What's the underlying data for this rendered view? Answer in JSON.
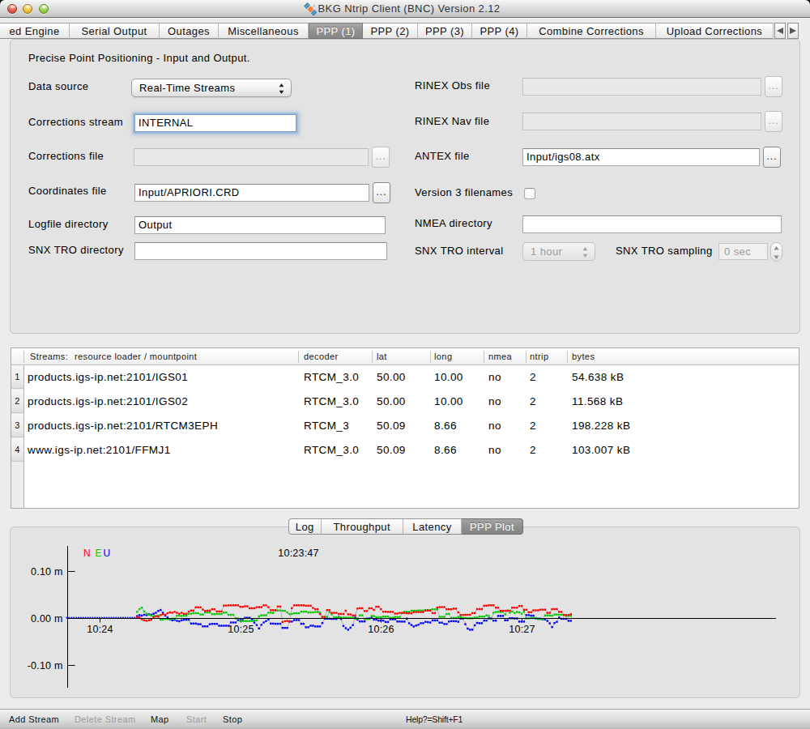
{
  "window": {
    "title": "BKG Ntrip Client (BNC) Version 2.12",
    "traffic_lights": [
      "close",
      "minimize",
      "zoom"
    ]
  },
  "tabs": {
    "items": [
      {
        "label": "ed Engine",
        "selected": false
      },
      {
        "label": "Serial Output",
        "selected": false
      },
      {
        "label": "Outages",
        "selected": false
      },
      {
        "label": "Miscellaneous",
        "selected": false
      },
      {
        "label": "PPP (1)",
        "selected": true
      },
      {
        "label": "PPP (2)",
        "selected": false
      },
      {
        "label": "PPP (3)",
        "selected": false
      },
      {
        "label": "PPP (4)",
        "selected": false
      },
      {
        "label": "Combine Corrections",
        "selected": false
      },
      {
        "label": "Upload Corrections",
        "selected": false
      }
    ],
    "scroll_left_icon": "left-triangle",
    "scroll_right_icon": "right-triangle"
  },
  "form": {
    "heading": "Precise Point Positioning - Input and Output.",
    "data_source": {
      "label": "Data source",
      "value": "Real-Time Streams"
    },
    "corrections_stream": {
      "label": "Corrections stream",
      "value": "INTERNAL"
    },
    "corrections_file": {
      "label": "Corrections file",
      "value": "",
      "browse": "..."
    },
    "coordinates_file": {
      "label": "Coordinates file",
      "value": "Input/APRIORI.CRD",
      "browse": "..."
    },
    "logfile_directory": {
      "label": "Logfile directory",
      "value": "Output"
    },
    "snx_tro_directory": {
      "label": "SNX TRO directory",
      "value": ""
    },
    "rinex_obs_file": {
      "label": "RINEX Obs file",
      "value": "",
      "browse": "..."
    },
    "rinex_nav_file": {
      "label": "RINEX Nav file",
      "value": "",
      "browse": "..."
    },
    "antex_file": {
      "label": "ANTEX file",
      "value": "Input/igs08.atx",
      "browse": "..."
    },
    "version3_filenames": {
      "label": "Version 3 filenames",
      "checked": false
    },
    "nmea_directory": {
      "label": "NMEA directory",
      "value": ""
    },
    "snx_tro_interval": {
      "label": "SNX TRO interval",
      "value": "1 hour"
    },
    "snx_tro_sampling": {
      "label": "SNX TRO sampling",
      "value": "0 sec"
    }
  },
  "table": {
    "header": {
      "streams_prefix": "Streams:",
      "col0": "resource loader / mountpoint",
      "cols": [
        "decoder",
        "lat",
        "long",
        "nmea",
        "ntrip",
        "bytes"
      ]
    },
    "rows": [
      {
        "num": "1",
        "mountpoint": "products.igs-ip.net:2101/IGS01",
        "decoder": "RTCM_3.0",
        "lat": "50.00",
        "long": "10.00",
        "nmea": "no",
        "ntrip": "2",
        "bytes": "54.638 kB"
      },
      {
        "num": "2",
        "mountpoint": "products.igs-ip.net:2101/IGS02",
        "decoder": "RTCM_3.0",
        "lat": "50.00",
        "long": "10.00",
        "nmea": "no",
        "ntrip": "2",
        "bytes": "11.568 kB"
      },
      {
        "num": "3",
        "mountpoint": "products.igs-ip.net:2101/RTCM3EPH",
        "decoder": "RTCM_3",
        "lat": "50.09",
        "long": "8.66",
        "nmea": "no",
        "ntrip": "2",
        "bytes": "198.228 kB"
      },
      {
        "num": "4",
        "mountpoint": "www.igs-ip.net:2101/FFMJ1",
        "decoder": "RTCM_3.0",
        "lat": "50.09",
        "long": "8.66",
        "nmea": "no",
        "ntrip": "2",
        "bytes": "103.007 kB"
      }
    ]
  },
  "bottom_tabs": {
    "items": [
      {
        "label": "Log",
        "selected": false
      },
      {
        "label": "Throughput",
        "selected": false
      },
      {
        "label": "Latency",
        "selected": false
      },
      {
        "label": "PPP Plot",
        "selected": true
      }
    ]
  },
  "chart_data": {
    "type": "scatter",
    "title": "10:23:47",
    "legend": [
      {
        "label": "N",
        "color": "#ff0000"
      },
      {
        "label": "E",
        "color": "#00cc00"
      },
      {
        "label": "U",
        "color": "#0000ff"
      }
    ],
    "ylabel_unit": "m",
    "yticks": [
      {
        "label": "0.10 m",
        "value": 0.1
      },
      {
        "label": "0.00 m",
        "value": 0.0
      },
      {
        "label": "-0.10 m",
        "value": -0.1
      }
    ],
    "ylim": [
      -0.13,
      0.13
    ],
    "xticks": [
      {
        "label": "10:24",
        "t": 13
      },
      {
        "label": "10:25",
        "t": 73
      },
      {
        "label": "10:26",
        "t": 133
      },
      {
        "label": "10:27",
        "t": 193
      }
    ],
    "time_origin": "10:23:47",
    "series": [
      {
        "name": "N",
        "color": "#ff0000",
        "t0": 29,
        "dt": 1,
        "values": [
          0.003,
          0.002,
          -0.002,
          -0.004,
          -0.005,
          -0.004,
          -0.003,
          0.002,
          0.005,
          0.004,
          0.007,
          0.009,
          0.008,
          0.011,
          0.013,
          0.012,
          0.014,
          0.012,
          0.01,
          0.012,
          0.0098,
          0.0098,
          0.0145,
          0.0168,
          0.0165,
          0.0236,
          0.0236,
          0.0236,
          0.0188,
          0.0158,
          0.0165,
          0.0165,
          0.0195,
          0.0195,
          0.0149,
          0.0149,
          0.0149,
          0.0274,
          0.0274,
          0.028,
          0.028,
          0.028,
          0.028,
          0.028,
          0.0247,
          0.0247,
          0.0258,
          0.0258,
          0.0218,
          0.0218,
          0.0218,
          0.024,
          0.024,
          0.024,
          0.028,
          0.028,
          0.024,
          0.0176,
          0.0176,
          0.0176,
          0.0254,
          0.0254,
          -0.0077,
          -0.006,
          -0.0051,
          -0.0065,
          0.0219,
          0.028,
          0.028,
          0.028,
          0.028,
          0.028,
          0.027,
          0.027,
          0.027,
          0.0224,
          0.0196,
          0.0196,
          0.0093,
          0.0028,
          0.0028,
          0.0178,
          0.0178,
          0.0119,
          0.0119,
          0.0119,
          0.0094,
          0.0094,
          0.0094,
          0.0163,
          0.0086,
          0.0086,
          0.0064,
          0.0064,
          0.0211,
          0.0218,
          0.0218,
          0.0159,
          0.0159,
          0.0215,
          0.0215,
          0.0181,
          0.0248,
          0.0248,
          0.0198,
          0.0143,
          0.0143,
          0.0139,
          0.0139,
          0.0139,
          0.0103,
          0.0103,
          0.0117,
          0.0117,
          0.0117,
          0.011,
          0.011,
          0.011,
          0.0136,
          0.0136,
          0.0136,
          0.0136,
          0.0136,
          0.0168,
          0.0168,
          0.0168,
          0.0114,
          0.0114,
          0.0231,
          0.0242,
          0.0242,
          0.0242,
          0.0194,
          0.0194,
          0.0194,
          0.0209,
          0.0209,
          0.013,
          0.0074,
          0.0074,
          0.0077,
          0.0077,
          0.0077,
          0.0114,
          0.0114,
          0.0198,
          0.0198,
          0.0198,
          0.027,
          0.027,
          0.028,
          0.028,
          0.028,
          0.0229,
          0.0229,
          0.0162,
          0.0162,
          0.0162,
          0.0164,
          0.0164,
          0.023,
          0.023,
          0.023,
          0.0263,
          0.0263,
          0.0184,
          0.0184,
          0.0132,
          0.0132,
          0.0172,
          0.0172,
          0.0172,
          0.0186,
          0.0186,
          0.0186,
          0.0119,
          0.0119,
          0.0198,
          0.0198,
          0.0198,
          0.0139,
          0.0139,
          0.0072,
          0.0072,
          0.0072,
          0.009
        ]
      },
      {
        "name": "E",
        "color": "#00cc00",
        "t0": 29,
        "dt": 1,
        "values": [
          0.014,
          0.02,
          0.023,
          0.015,
          0.01,
          0.008,
          0.006,
          0.005,
          0.004,
          0.006,
          -0.0026,
          -0.0026,
          -0.0012,
          -0.0012,
          -0.0012,
          -0.0006,
          -0.0006,
          0.0059,
          0.0059,
          0.0051,
          0.0057,
          0.0057,
          0.01,
          0.01,
          0.0112,
          0.0112,
          0.0112,
          0.0082,
          0.0082,
          0.0129,
          0.0129,
          0.0129,
          0.0092,
          0.0092,
          0.0095,
          0.0095,
          0.0095,
          0.0125,
          0.0125,
          0.0077,
          0.0077,
          0.0077,
          0.0001,
          0.0001,
          -0.0056,
          -0.0056,
          -0.0056,
          -0.0056,
          -0.0056,
          -0.0056,
          -0.0041,
          -0.0041,
          0.0044,
          0.0068,
          0.0068,
          0.0068,
          0.0123,
          0.0123,
          0.0118,
          0.0169,
          0.0169,
          0.0169,
          0.0164,
          0.0164,
          0.0128,
          0.0094,
          0.0094,
          0.011,
          0.011,
          0.011,
          0.0144,
          0.0144,
          0.0144,
          0.013,
          0.013,
          0.013,
          0.0137,
          0.0137,
          0.0127,
          0.0037,
          0.0037,
          0.0037,
          0.0136,
          0.009,
          0.0025,
          0.0025,
          0.0025,
          0.0018,
          0.0018,
          0.0018,
          0.0016,
          0.0016,
          0.0016,
          -0.0006,
          -0.0006,
          0.0066,
          0.0066,
          -0.0012,
          -0.0012,
          -0.0012,
          0.005,
          0.005,
          0.0025,
          0.0025,
          0.0025,
          0.004,
          0.004,
          0.004,
          0.0013,
          0.0013,
          0.0031,
          0.0031,
          0.0031,
          0.0112,
          0.0142,
          0.0142,
          0.0142,
          0.0164,
          0.0164,
          0.0164,
          0.0169,
          0.0169,
          0.0169,
          0.0177,
          0.0177,
          0.0177,
          0.0193,
          0.0193,
          0.0193,
          0.0035,
          0.0035,
          0.0035,
          0.0096,
          0.0096,
          0.0011,
          0.0011,
          0.0011,
          0.0035,
          0.0035,
          0.0011,
          0.0011,
          0.0003,
          0.0003,
          0.0003,
          0.0019,
          0.0019,
          0.0039,
          0.0039,
          0.0039,
          0.0068,
          0.0054,
          -0.001,
          0.0121,
          0.0136,
          0.0139,
          0.0136,
          0.0143,
          0.0085,
          0.0169,
          0.0122,
          0.0149,
          0.0116,
          0.0138,
          0.013,
          0.0099,
          0.0143,
          0.0002,
          0.0002,
          0.0011,
          0.0011,
          0.0011,
          -0.0013,
          -0.0013,
          -0.0013,
          0.0064,
          0.0064,
          0.0064,
          0.0059,
          0.0083,
          0.0083,
          0.0077,
          0.0077,
          0.0077,
          0.0054,
          0.0054,
          0.0054
        ]
      },
      {
        "name": "U",
        "color": "#0000ff",
        "t0": 29,
        "dt": 1,
        "values": [
          0.005,
          0.007,
          0.006,
          0.008,
          0.007,
          0.009,
          0.008,
          0.01,
          0.012,
          0.016,
          0.018,
          0.012,
          0.006,
          0.002,
          -0.002,
          -0.004,
          -0.003,
          -0.005,
          -0.006,
          -0.004,
          -0.0028,
          -0.0028,
          -0.0028,
          -0.0109,
          -0.0109,
          -0.0109,
          -0.0123,
          -0.0123,
          -0.0169,
          -0.0169,
          -0.0169,
          -0.0122,
          -0.0116,
          -0.0116,
          -0.0116,
          -0.0155,
          -0.0155,
          -0.0155,
          -0.0155,
          -0.0155,
          -0.0087,
          -0.0087,
          -0.0087,
          -0.0035,
          -0.0035,
          -0.0035,
          0.0014,
          0.0014,
          0.0014,
          -0.0021,
          -0.0088,
          -0.0139,
          -0.0212,
          -0.0136,
          -0.0087,
          -0.0057,
          -0.0022,
          -0.0111,
          -0.0111,
          -0.0114,
          -0.0114,
          -0.0114,
          -0.0201,
          -0.0201,
          -0.0201,
          -0.0065,
          -0.0065,
          -0.0035,
          -0.0035,
          -0.0035,
          -0.0114,
          -0.0114,
          -0.0188,
          -0.0188,
          -0.0156,
          -0.0156,
          -0.0171,
          -0.0171,
          -0.0171,
          -0.0098,
          -0.0006,
          -0.0006,
          -0.0006,
          -0.0011,
          -0.0011,
          -0.0011,
          0.0031,
          -0.0012,
          -0.016,
          -0.0207,
          -0.024,
          -0.0198,
          -0.0142,
          0.0019,
          -0.0026,
          -0.0063,
          -0.0063,
          -0.0063,
          -0.0002,
          -0.0002,
          0.002,
          -0.0025,
          -0.0025,
          -0.0046,
          -0.0046,
          -0.0046,
          -0.0076,
          -0.0076,
          -0.0019,
          -0.0019,
          -0.0019,
          -0.0065,
          -0.0065,
          -0.0068,
          -0.0068,
          -0.0005,
          -0.0104,
          -0.0139,
          -0.0173,
          -0.0151,
          -0.0135,
          -0.0101,
          -0.0101,
          -0.0073,
          -0.0079,
          -0.0088,
          -0.0041,
          -0.0041,
          -0.0041,
          -0.009,
          -0.009,
          -0.0119,
          -0.0119,
          -0.0065,
          -0.0059,
          -0.0059,
          -0.0059,
          -0.0071,
          -0.0001,
          -0.0001,
          -0.0123,
          -0.0217,
          -0.024,
          -0.024,
          -0.0146,
          -0.0094,
          -0.0101,
          -0.0101,
          -0.0045,
          -0.0045,
          0.0001,
          0.0001,
          -0.0047,
          -0.0047,
          0.0054,
          0.0054,
          0.0054,
          -0.004,
          -0.004,
          0.0006,
          0.0006,
          0.0,
          0.0,
          -0.0068,
          -0.0068,
          -0.0068,
          0.0071,
          0.0071,
          0.0059,
          0.0059,
          0.0001,
          -0.0007,
          -0.0007,
          -0.0021,
          -0.0021,
          -0.0052,
          -0.0106,
          -0.0184,
          -0.0098,
          -0.0072,
          0.0019,
          -0.0008,
          -0.0008,
          -0.0008,
          -0.005,
          -0.005
        ]
      },
      {
        "name": "U_warmup",
        "color": "#0000ff",
        "t0": -1,
        "dt": 1,
        "values": [
          0.0,
          0.0,
          0.0,
          0.0,
          0.0,
          0.0,
          0.0,
          0.0,
          0.0,
          0.0,
          0.0,
          0.0,
          0.0,
          0.0,
          0.0,
          0.0,
          0.0,
          0.0,
          0.0,
          0.0,
          0.0,
          0.0,
          0.0,
          0.0,
          0.0,
          0.0,
          0.0,
          0.0,
          0.0,
          0.0,
          0.0
        ]
      }
    ]
  },
  "toolbar": {
    "items": [
      {
        "label": "Add Stream",
        "enabled": true
      },
      {
        "label": "Delete Stream",
        "enabled": false
      },
      {
        "label": "Map",
        "enabled": true
      },
      {
        "label": "Start",
        "enabled": false
      },
      {
        "label": "Stop",
        "enabled": true
      }
    ],
    "help": "Help?=Shift+F1"
  }
}
